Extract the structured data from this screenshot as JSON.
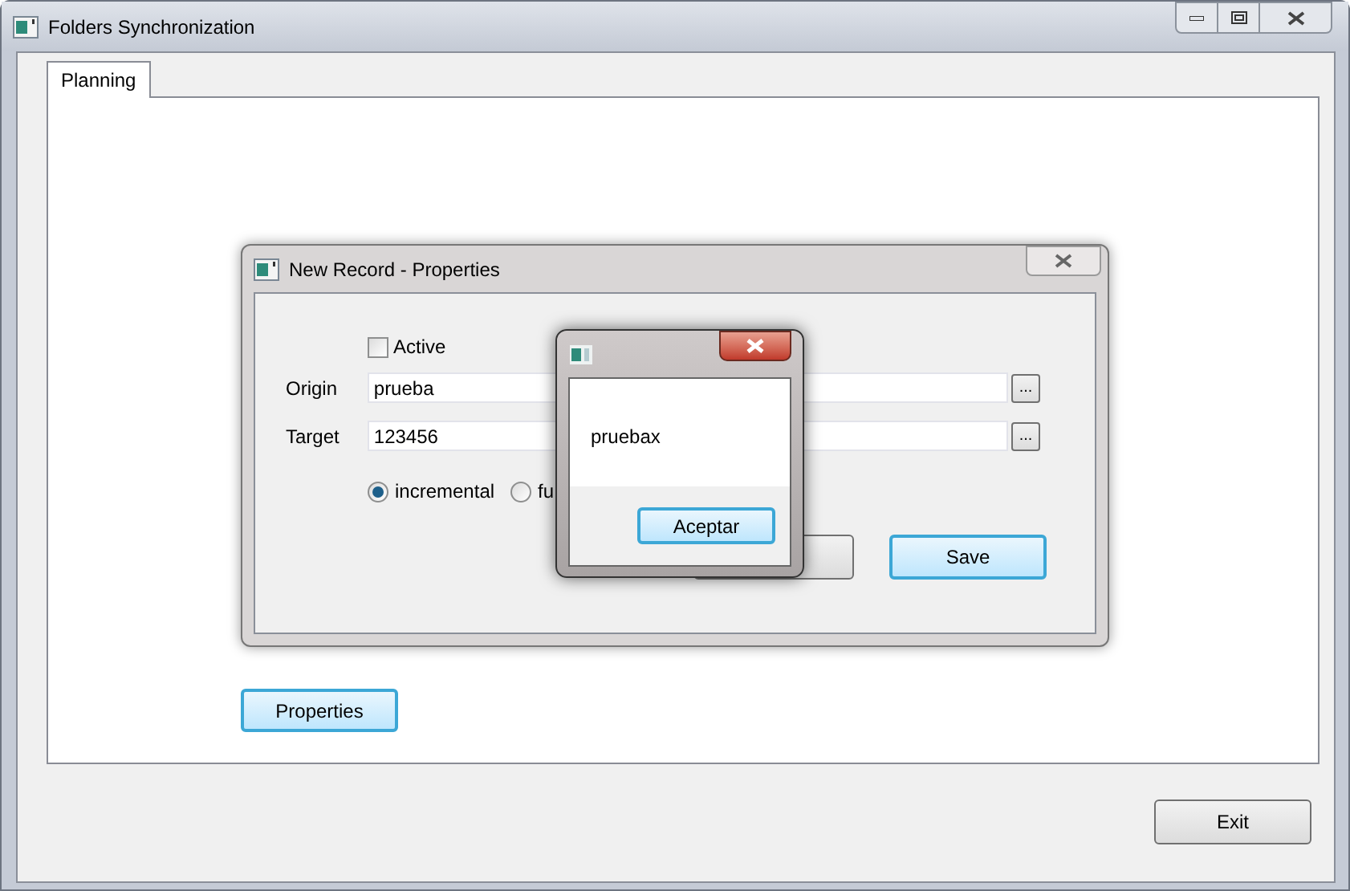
{
  "window": {
    "title": "Folders Synchronization"
  },
  "tabs": [
    {
      "label": "Planning",
      "selected": true
    }
  ],
  "properties_button": "Properties",
  "exit_button": "Exit",
  "dialog": {
    "title": "New Record - Properties",
    "active": {
      "label": "Active",
      "checked": false
    },
    "fields": [
      {
        "label": "Origin",
        "value": "prueba",
        "browse": "..."
      },
      {
        "label": "Target",
        "value": "123456",
        "browse": "..."
      }
    ],
    "modes": [
      {
        "label": "incremental",
        "selected": true
      },
      {
        "label": "fu",
        "selected": false
      }
    ],
    "save_button": "Save"
  },
  "message_box": {
    "text": "pruebax",
    "button": "Aceptar"
  }
}
